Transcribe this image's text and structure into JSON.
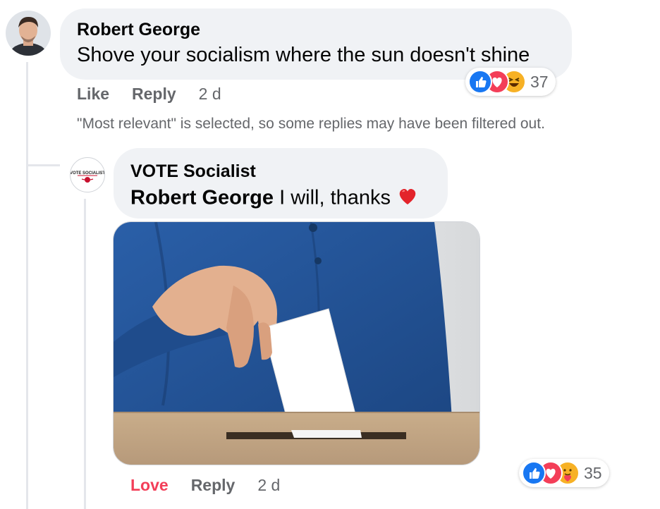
{
  "comment": {
    "author": "Robert George",
    "text": "Shove your socialism where the sun doesn't shine",
    "actions": {
      "like": "Like",
      "reply": "Reply"
    },
    "time": "2 d",
    "reactions": {
      "icons": [
        "like-icon",
        "love-icon",
        "haha-icon"
      ],
      "count": "37"
    }
  },
  "filter_notice": "\"Most relevant\" is selected, so some replies may have been filtered out.",
  "reply": {
    "author": "VOTE Socialist",
    "avatar_text": "VOTE SOCIALIST",
    "mention": "Robert George",
    "text": " I will, thanks ",
    "emoji": "heart-emoji",
    "photo": "hand-casting-ballot-into-box",
    "actions": {
      "love": "Love",
      "reply": "Reply"
    },
    "time": "2 d",
    "reactions": {
      "icons": [
        "like-icon",
        "love-icon",
        "care-icon"
      ],
      "count": "35"
    }
  },
  "colors": {
    "bubble": "#f0f2f5",
    "secondary_text": "#65676b",
    "love": "#f33e58",
    "like_blue": "#1877f2"
  }
}
